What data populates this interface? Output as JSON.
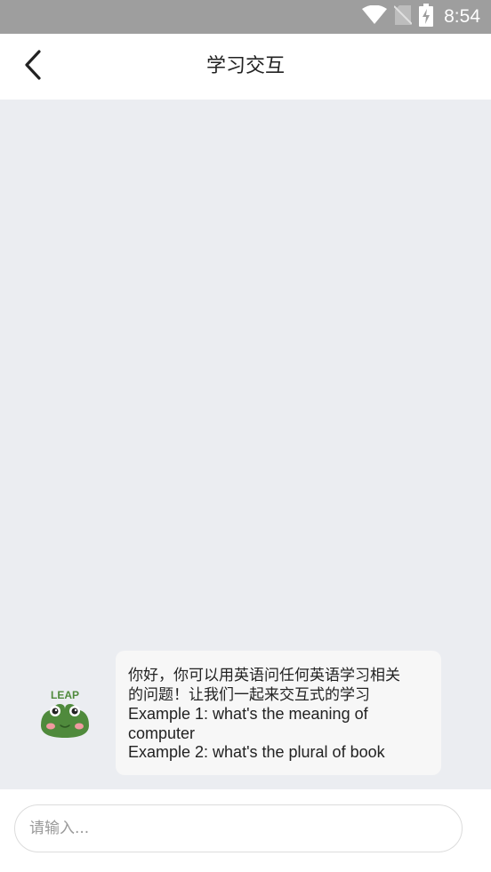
{
  "status_bar": {
    "time": "8:54",
    "icons": [
      "wifi-icon",
      "no-sim-icon",
      "battery-charging-icon"
    ]
  },
  "header": {
    "back_icon": "chevron-left-icon",
    "title": "学习交互"
  },
  "chat": {
    "messages": [
      {
        "sender": "bot",
        "avatar_label": "LEAP",
        "lines": [
          "你好，你可以用英语问任何英语学习相关",
          "的问题！让我们一起来交互式的学习",
          "Example 1: what's the meaning of",
          "computer",
          "Example 2: what's the plural of book"
        ]
      }
    ]
  },
  "input": {
    "placeholder": "请输入...",
    "value": ""
  },
  "colors": {
    "status_bar": "#9e9e9e",
    "background": "#ebedf1",
    "bubble": "#f7f7f7",
    "frog_green": "#4f8a3c"
  }
}
